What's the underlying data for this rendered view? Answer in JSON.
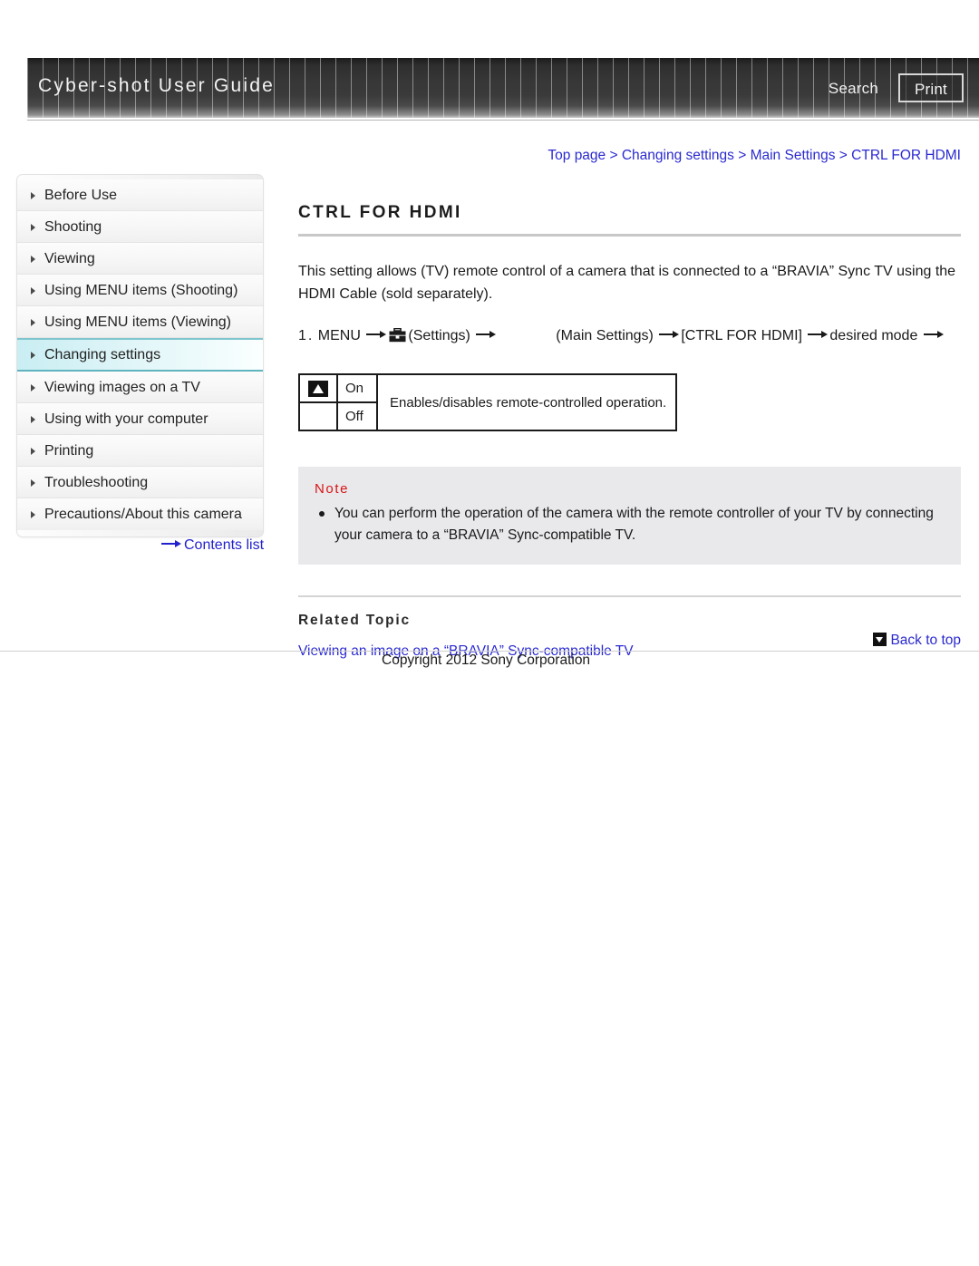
{
  "header": {
    "site_title": "Cyber-shot User Guide",
    "search_label": "Search",
    "print_label": "Print"
  },
  "sidebar": {
    "items": [
      {
        "label": "Before Use",
        "selected": false
      },
      {
        "label": "Shooting",
        "selected": false
      },
      {
        "label": "Viewing",
        "selected": false
      },
      {
        "label": "Using MENU items (Shooting)",
        "selected": false
      },
      {
        "label": "Using MENU items (Viewing)",
        "selected": false
      },
      {
        "label": "Changing settings",
        "selected": true
      },
      {
        "label": "Viewing images on a TV",
        "selected": false
      },
      {
        "label": "Using with your computer",
        "selected": false
      },
      {
        "label": "Printing",
        "selected": false
      },
      {
        "label": "Troubleshooting",
        "selected": false
      },
      {
        "label": "Precautions/About this camera",
        "selected": false
      }
    ],
    "contents_list_label": "Contents list"
  },
  "breadcrumb": {
    "text": "Top page > Changing settings > Main Settings > CTRL FOR HDMI"
  },
  "main": {
    "title": "CTRL FOR HDMI",
    "intro": "This setting allows (TV) remote control of a camera that is connected to a “BRAVIA” Sync TV using the HDMI Cable (sold separately).",
    "step": {
      "number": "1.",
      "menu_label": "MENU",
      "settings_label": "(Settings)",
      "main_settings_label": "(Main Settings)",
      "item_label": "[CTRL FOR HDMI]",
      "mode_label": "desired mode"
    },
    "option_table": {
      "rows": [
        {
          "marker": "default",
          "label": "On"
        },
        {
          "marker": "",
          "label": "Off"
        }
      ],
      "description": "Enables/disables remote-controlled operation."
    },
    "note": {
      "title": "Note",
      "body": "You can perform the operation of the camera with the remote controller of your TV by connecting your camera to a “BRAVIA” Sync-compatible TV."
    },
    "related": {
      "title": "Related Topic",
      "link": "Viewing an image on a “BRAVIA” Sync-compatible TV"
    }
  },
  "footer": {
    "back_to_top_label": "Back to top",
    "copyright": "Copyright 2012 Sony Corporation"
  },
  "colors": {
    "link": "#2a2ad0",
    "note_title": "#d61616",
    "selected_nav": "#c9eef3"
  }
}
